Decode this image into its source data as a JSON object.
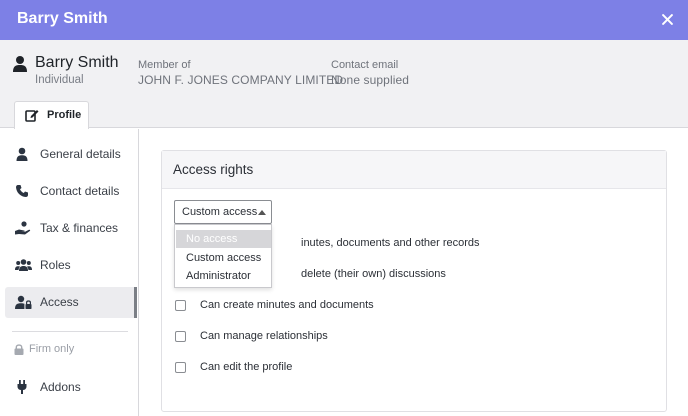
{
  "window": {
    "title": "Barry Smith"
  },
  "profile": {
    "name": "Barry Smith",
    "type": "Individual",
    "member_label": "Member of",
    "member_value": "JOHN F. JONES COMPANY LIMITED",
    "contact_label": "Contact email",
    "contact_value": "None supplied"
  },
  "tabs": [
    {
      "label": "Profile",
      "icon": "edit-icon",
      "active": true
    }
  ],
  "sidebar": {
    "items": [
      {
        "label": "General details",
        "icon": "user-icon"
      },
      {
        "label": "Contact details",
        "icon": "phone-icon"
      },
      {
        "label": "Tax & finances",
        "icon": "hand-coin-icon"
      },
      {
        "label": "Roles",
        "icon": "users-icon"
      },
      {
        "label": "Access",
        "icon": "user-lock-icon",
        "active": true
      }
    ],
    "firm_only": "Firm only",
    "addons": {
      "label": "Addons",
      "icon": "plug-icon"
    }
  },
  "access": {
    "title": "Access rights",
    "selected": "Custom access",
    "options": [
      "No access",
      "Custom access",
      "Administrator"
    ],
    "permissions": [
      {
        "label": "inutes, documents and other records"
      },
      {
        "label": "delete (their own) discussions"
      },
      {
        "label": "Can create minutes and documents"
      },
      {
        "label": "Can manage relationships"
      },
      {
        "label": "Can edit the profile"
      }
    ]
  },
  "colors": {
    "titlebar": "#7d80e6",
    "header_bg": "#f1f1f3",
    "active_nav": "#ececef"
  }
}
